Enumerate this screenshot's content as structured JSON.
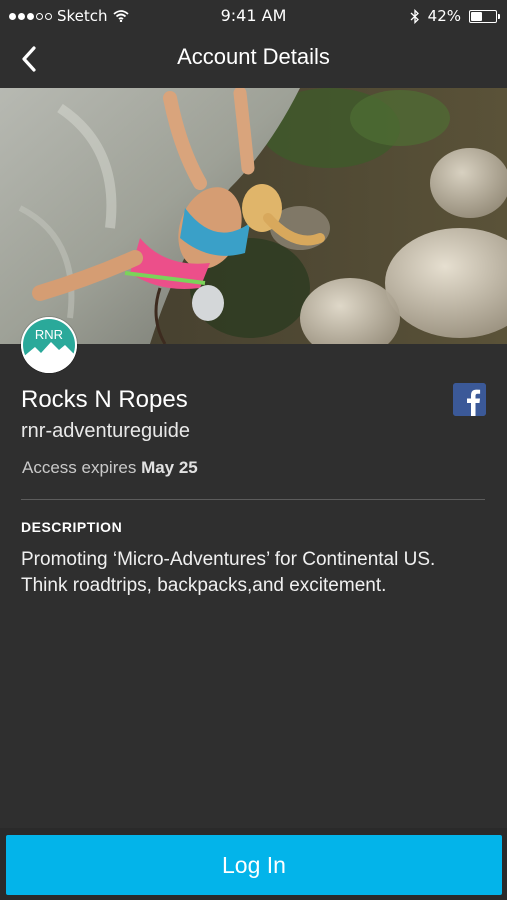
{
  "status_bar": {
    "carrier": "Sketch",
    "time": "9:41 AM",
    "battery_percent": "42%",
    "battery_level": 0.42,
    "icons": [
      "signal-dots-icon",
      "wifi-icon",
      "bluetooth-icon",
      "battery-icon"
    ]
  },
  "nav": {
    "title": "Account Details",
    "back_icon": "chevron-left-icon"
  },
  "hero": {
    "image": "rock-climber-photo"
  },
  "account": {
    "avatar_text": "RNR",
    "avatar_color": "#2aa99a",
    "name": "Rocks N Ropes",
    "handle": "rnr-adventureguide",
    "access_label": "Access expires",
    "access_date": "May 25",
    "facebook_icon": "facebook-icon"
  },
  "description": {
    "heading": "DESCRIPTION",
    "line1": "Promoting ‘Micro-Adventures’ for Continental US.",
    "line2": "Think roadtrips, backpacks,and excitement."
  },
  "actions": {
    "login_label": "Log In"
  },
  "colors": {
    "background": "#2f2f2f",
    "accent": "#03b4ea",
    "facebook": "#3b5998"
  }
}
